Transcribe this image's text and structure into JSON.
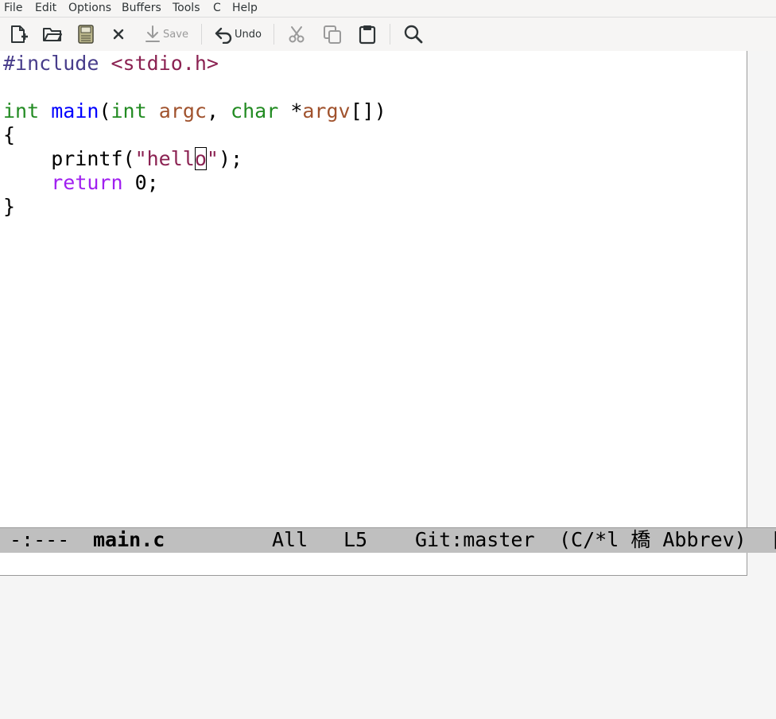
{
  "menubar": {
    "items": [
      "File",
      "Edit",
      "Options",
      "Buffers",
      "Tools",
      "C",
      "Help"
    ]
  },
  "toolbar": {
    "new_file_icon": "new-file-icon",
    "open_icon": "folder-open-icon",
    "save_buffer_icon": "floppy-icon",
    "close_icon": "close-icon",
    "save_label": "Save",
    "undo_label": "Undo",
    "cut_icon": "scissors-icon",
    "copy_icon": "copy-icon",
    "paste_icon": "clipboard-icon",
    "search_icon": "search-icon"
  },
  "editor": {
    "lines": [
      {
        "parts": [
          {
            "t": "#include ",
            "c": "pre"
          },
          {
            "t": "<stdio.h>",
            "c": "str"
          }
        ]
      },
      {
        "parts": []
      },
      {
        "parts": [
          {
            "t": "int",
            "c": "type"
          },
          {
            "t": " ",
            "c": ""
          },
          {
            "t": "main",
            "c": "fn"
          },
          {
            "t": "(",
            "c": ""
          },
          {
            "t": "int",
            "c": "type"
          },
          {
            "t": " ",
            "c": ""
          },
          {
            "t": "argc",
            "c": "var"
          },
          {
            "t": ", ",
            "c": ""
          },
          {
            "t": "char",
            "c": "type"
          },
          {
            "t": " *",
            "c": ""
          },
          {
            "t": "argv",
            "c": "var"
          },
          {
            "t": "[])",
            "c": ""
          }
        ]
      },
      {
        "parts": [
          {
            "t": "{",
            "c": ""
          }
        ]
      },
      {
        "parts": [
          {
            "t": "    printf(",
            "c": ""
          },
          {
            "t": "\"hell",
            "c": "str"
          },
          {
            "t": "o",
            "c": "str cursor"
          },
          {
            "t": "\"",
            "c": "str"
          },
          {
            "t": ");",
            "c": ""
          }
        ]
      },
      {
        "parts": [
          {
            "t": "    ",
            "c": ""
          },
          {
            "t": "return",
            "c": "kw"
          },
          {
            "t": " 0;",
            "c": ""
          }
        ]
      },
      {
        "parts": [
          {
            "t": "}",
            "c": ""
          }
        ]
      }
    ]
  },
  "modeline": {
    "status": "-:---",
    "buffer_name": "main.c",
    "position": "All",
    "line": "L5",
    "vc": "Git:master",
    "modes": "(C/*l 橋 Abbrev)",
    "overflow": "["
  },
  "minibuffer": {
    "text": ""
  }
}
